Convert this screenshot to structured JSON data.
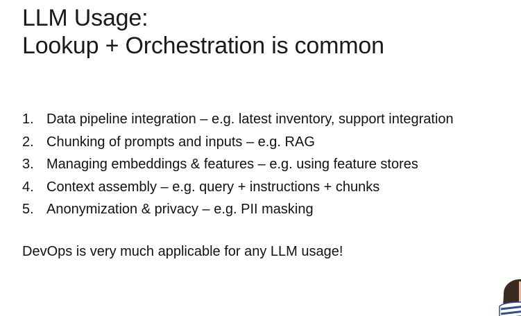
{
  "slide": {
    "title_line1": "LLM Usage:",
    "title_line2": "Lookup + Orchestration is common",
    "items": [
      {
        "number": "1.",
        "text": "Data pipeline integration – e.g. latest inventory, support integration"
      },
      {
        "number": "2.",
        "text": "Chunking of prompts and inputs – e.g. RAG"
      },
      {
        "number": "3.",
        "text": "Managing embeddings & features – e.g. using feature stores"
      },
      {
        "number": "4.",
        "text": "Context assembly – e.g. query + instructions + chunks"
      },
      {
        "number": "5.",
        "text": "Anonymization & privacy – e.g. PII masking"
      }
    ],
    "footer": "DevOps is very much applicable for any LLM usage!"
  },
  "colors": {
    "background": "#ffffff",
    "text": "#111111",
    "avatar_stripe_blue": "#2f4f8f",
    "avatar_stripe_white": "#ffffff",
    "avatar_hair": "#3a2a20",
    "avatar_skin": "#e8b9a0"
  },
  "icons": {
    "corner_avatar": "presenter-avatar-icon"
  }
}
